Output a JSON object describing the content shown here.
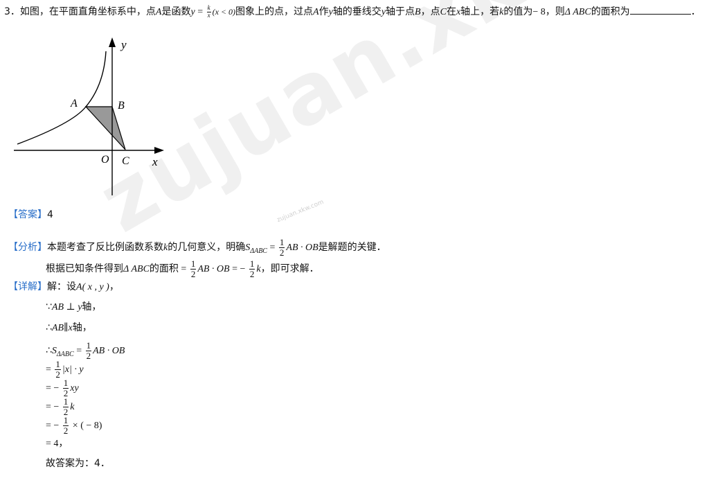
{
  "question": {
    "number": "3．",
    "stem_a": "如图，在平面直角坐标系中，点",
    "point_a": "A",
    "stem_b": "是函数",
    "func_y": "y",
    "func_eq": " = ",
    "func_k": "k",
    "func_x": "x",
    "func_cond": "(x < 0)",
    "stem_c": "图象上的点，过点",
    "stem_d": "作",
    "axis_y": "y",
    "stem_e": "轴的垂线交",
    "stem_f": "轴于点",
    "point_b": "B",
    "stem_g": "，点",
    "point_c": "C",
    "stem_h": "在",
    "axis_x": "x",
    "stem_i": "轴上，若",
    "var_k": "k",
    "stem_j": "的值为",
    "k_value": "− 8",
    "stem_k": "，则",
    "triangle": "Δ ABC",
    "stem_l": "的面积为",
    "stem_end": "．"
  },
  "figure": {
    "label_y": "y",
    "label_x": "x",
    "label_a": "A",
    "label_b": "B",
    "label_o": "O",
    "label_c": "C",
    "axis_color": "#000000",
    "triangle_fill": "#999999"
  },
  "answer": {
    "tag": "【答案】",
    "value": "4"
  },
  "analysis": {
    "tag": "【分析】",
    "l1_a": "本题考查了反比例函数系数",
    "l1_k": "k",
    "l1_b": "的几何意义，明确",
    "l1_s": "S",
    "l1_sub": "ΔABC",
    "l1_eq": " = ",
    "half_num": "1",
    "half_den": "2",
    "l1_prod": "AB · OB",
    "l1_c": "是解题的关键．",
    "l2_a": "根据已知条件得到",
    "l2_tri": "Δ ABC",
    "l2_b": "的面积",
    "l2_eq": " = ",
    "l2_prod": "AB · OB",
    "l2_eq2": " = − ",
    "l2_k": "k",
    "l2_c": "，即可求解．"
  },
  "solution": {
    "tag": "【详解】",
    "s1_a": "解：设",
    "s1_pt": "A",
    "s1_coord": "( x , y )",
    "s1_end": "，",
    "s2_pre": "∵",
    "s2_expr": "AB ⊥ y",
    "s2_end": "轴，",
    "s3_pre": "∴",
    "s3_expr": "AB∥x",
    "s3_end": "轴，",
    "s4_pre": "∴",
    "s4_s": "S",
    "s4_sub": "ΔABC",
    "s4_eq": " = ",
    "s4_prod": "AB · OB",
    "s5_eq": "= ",
    "s5_expr": "|x| · y",
    "s6_eq": "= − ",
    "s6_expr": "xy",
    "s7_eq": "= − ",
    "s7_expr": "k",
    "s8_eq": "= − ",
    "s8_expr": " × ( − 8)",
    "s9": "= 4，",
    "s10": "故答案为：4．"
  },
  "watermark": {
    "big": "zujuan.xkw.com",
    "small": "zujuan.xkw.com"
  }
}
